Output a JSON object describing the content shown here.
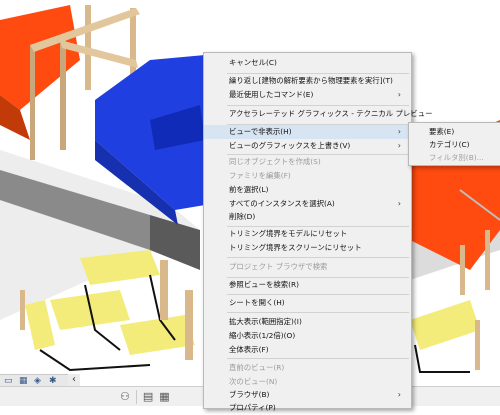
{
  "context_menu": {
    "items": [
      {
        "label": "キャンセル(C)",
        "disabled": false,
        "submenu": false
      },
      {
        "label": "繰り返し[建物の解析要素から物理要素を実行](T)",
        "disabled": false,
        "submenu": false
      },
      {
        "label": "最近使用したコマンド(E)",
        "disabled": false,
        "submenu": true
      },
      {
        "label": "アクセラレーテッド グラフィックス - テクニカル プレビュー",
        "disabled": false,
        "submenu": false
      },
      {
        "label": "ビューで非表示(H)",
        "disabled": false,
        "submenu": true,
        "highlighted": true
      },
      {
        "label": "ビューのグラフィックスを上書き(V)",
        "disabled": false,
        "submenu": true
      },
      {
        "label": "同じオブジェクトを作成(S)",
        "disabled": true,
        "submenu": false
      },
      {
        "label": "ファミリを編集(F)",
        "disabled": true,
        "submenu": false
      },
      {
        "label": "前を選択(L)",
        "disabled": false,
        "submenu": false
      },
      {
        "label": "すべてのインスタンスを選択(A)",
        "disabled": false,
        "submenu": true
      },
      {
        "label": "削除(D)",
        "disabled": false,
        "submenu": false
      },
      {
        "label": "トリミング境界をモデルにリセット",
        "disabled": false,
        "submenu": false
      },
      {
        "label": "トリミング境界をスクリーンにリセット",
        "disabled": false,
        "submenu": false
      },
      {
        "label": "プロジェクト ブラウザで検索",
        "disabled": true,
        "submenu": false
      },
      {
        "label": "参照ビューを検索(R)",
        "disabled": false,
        "submenu": false
      },
      {
        "label": "シートを開く(H)",
        "disabled": false,
        "submenu": false
      },
      {
        "label": "拡大表示(範囲指定)(I)",
        "disabled": false,
        "submenu": false
      },
      {
        "label": "縮小表示(1/2倍)(O)",
        "disabled": false,
        "submenu": false
      },
      {
        "label": "全体表示(F)",
        "disabled": false,
        "submenu": false
      },
      {
        "label": "直前のビュー(R)",
        "disabled": true,
        "submenu": false
      },
      {
        "label": "次のビュー(N)",
        "disabled": true,
        "submenu": false
      },
      {
        "label": "ブラウザ(B)",
        "disabled": false,
        "submenu": true
      },
      {
        "label": "プロパティ(P)",
        "disabled": false,
        "submenu": false
      }
    ]
  },
  "submenu": {
    "items": [
      {
        "label": "要素(E)",
        "disabled": false
      },
      {
        "label": "カテゴリ(C)",
        "disabled": false
      },
      {
        "label": "フィルタ別(B)...",
        "disabled": true
      }
    ]
  },
  "colors": {
    "menu_bg": "#f0f0f0",
    "menu_highlight": "#d7e4f2",
    "sofa_blue": "#1f3fe0",
    "sofa_orange": "#ff4a10",
    "chair_yellow": "#f3ec7a",
    "wood": "#d9b98c"
  },
  "icons": {
    "submenu_arrow": "›",
    "scroll_left": "‹"
  }
}
